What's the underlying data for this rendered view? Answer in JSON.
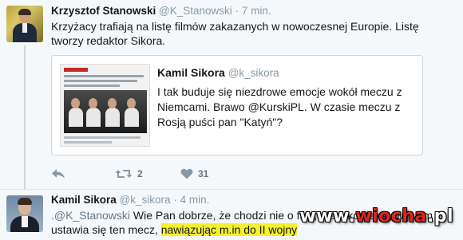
{
  "tweet1": {
    "author_name": "Krzysztof Stanowski",
    "author_handle": "@K_Stanowski",
    "separator": "·",
    "time": "7 min.",
    "text": "Krzyżacy trafiają na listę filmów zakazanych w nowoczesnej Europie. Listę tworzy redaktor Sikora.",
    "actions": {
      "reply_icon": "reply-icon",
      "retweet_icon": "retweet-icon",
      "retweet_count": "2",
      "like_icon": "heart-icon",
      "like_count": "31"
    }
  },
  "quoted": {
    "author_name": "Kamil Sikora",
    "author_handle": "@k_sikora",
    "text": "I tak buduje się niezdrowe emocje wokół meczu z Niemcami. Brawo @KurskiPL. W czasie meczu z Rosją puści pan \"Katyń\"?"
  },
  "tweet2": {
    "author_name": "Kamil Sikora",
    "author_handle": "@k_sikora",
    "separator": "·",
    "time": "4 min.",
    "text_mention": ".@K_Stanowski",
    "text_main": " Wie Pan dobrze, że chodzi nie o film, ale o kontekst, w jakim ustawia się ten mecz, ",
    "text_highlight": "nawiązując m.in do II wojny"
  },
  "watermark": {
    "prefix": "www.",
    "brand": "wiocha",
    "suffix": ".pl"
  },
  "colors": {
    "name": "#14171a",
    "muted": "#8899a6",
    "highlight": "#f6f02e",
    "watermark_red": "#e0261b"
  }
}
